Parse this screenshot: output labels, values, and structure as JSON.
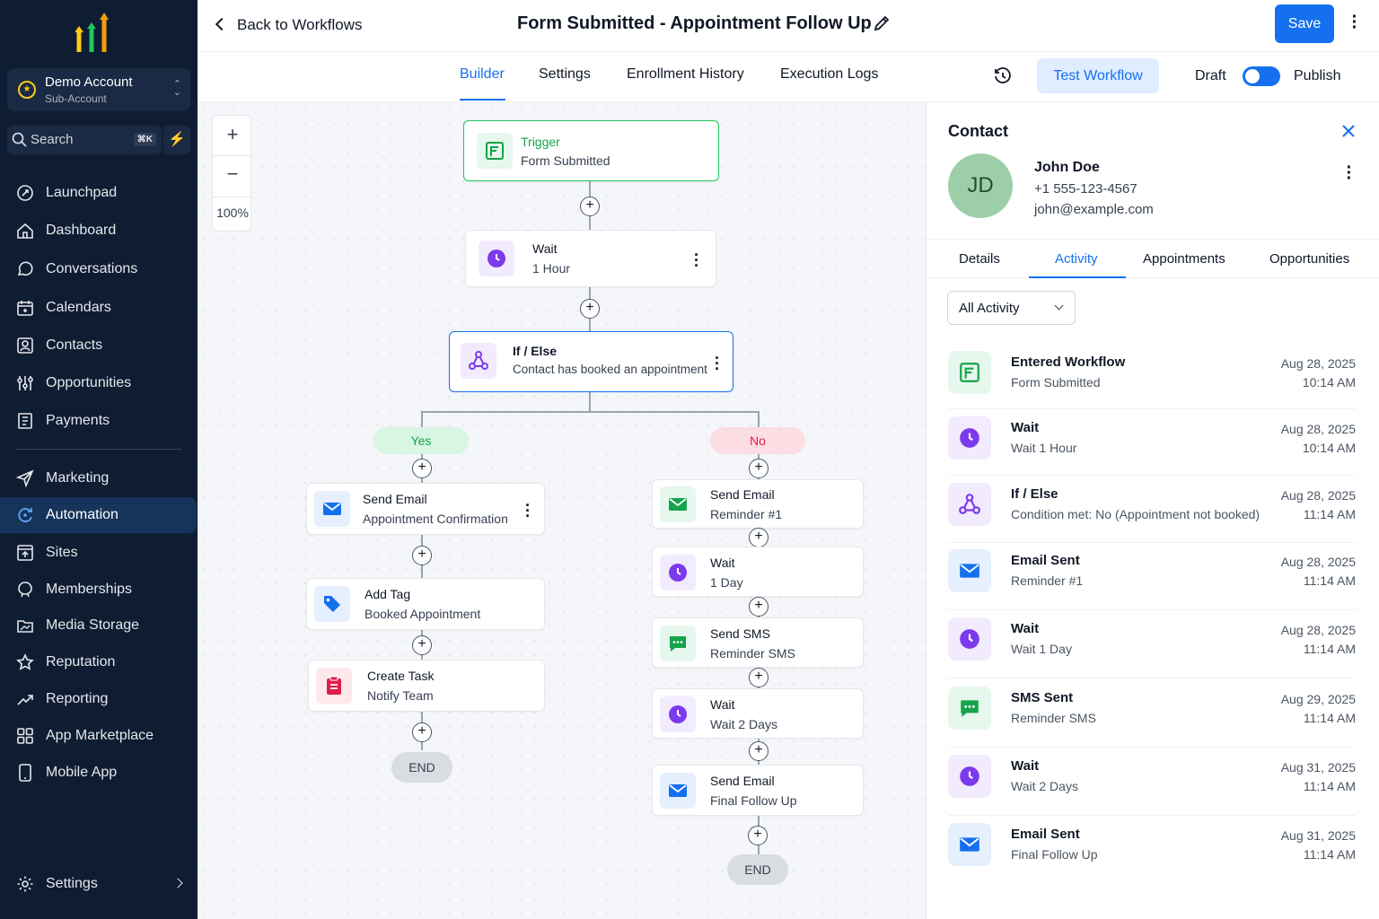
{
  "sidebar": {
    "account_name": "Demo Account",
    "account_sub": "Sub-Account",
    "search_label": "Search",
    "search_shortcut": "⌘K",
    "items": [
      {
        "label": "Launchpad",
        "icon": "rocket-icon"
      },
      {
        "label": "Dashboard",
        "icon": "dashboard-icon"
      },
      {
        "label": "Conversations",
        "icon": "chat-icon"
      },
      {
        "label": "Calendars",
        "icon": "calendar-icon"
      },
      {
        "label": "Contacts",
        "icon": "contact-icon"
      },
      {
        "label": "Opportunities",
        "icon": "funnel-icon"
      },
      {
        "label": "Payments",
        "icon": "receipt-icon"
      },
      {
        "label": "Marketing",
        "icon": "send-icon"
      },
      {
        "label": "Automation",
        "icon": "automation-icon"
      },
      {
        "label": "Sites",
        "icon": "sites-icon"
      },
      {
        "label": "Memberships",
        "icon": "membership-icon"
      },
      {
        "label": "Media Storage",
        "icon": "folder-icon"
      },
      {
        "label": "Reputation",
        "icon": "star-icon"
      },
      {
        "label": "Reporting",
        "icon": "chart-icon"
      },
      {
        "label": "App Marketplace",
        "icon": "grid-icon"
      },
      {
        "label": "Mobile App",
        "icon": "phone-icon"
      }
    ],
    "settings_label": "Settings",
    "active": "Automation"
  },
  "header": {
    "back_label": "Back to Workflows",
    "title": "Form Submitted - Appointment Follow Up",
    "save_label": "Save"
  },
  "tabs": {
    "items": [
      "Builder",
      "Settings",
      "Enrollment History",
      "Execution Logs"
    ],
    "active": "Builder",
    "test_label": "Test Workflow",
    "draft_label": "Draft",
    "publish_label": "Publish"
  },
  "canvas": {
    "zoom_in": "+",
    "zoom_out": "−",
    "zoom_level": "100%",
    "trigger": {
      "title": "Trigger",
      "subtitle": "Form Submitted"
    },
    "wait1": {
      "title": "Wait",
      "subtitle": "1 Hour"
    },
    "ifelse": {
      "title": "If / Else",
      "subtitle": "Contact has booked an appointment"
    },
    "yes_label": "Yes",
    "no_label": "No",
    "yes_branch": [
      {
        "title": "Send Email",
        "subtitle": "Appointment Confirmation"
      },
      {
        "title": "Add Tag",
        "subtitle": "Booked Appointment"
      },
      {
        "title": "Create Task",
        "subtitle": "Notify Team"
      }
    ],
    "no_branch": [
      {
        "title": "Send Email",
        "subtitle": "Reminder #1"
      },
      {
        "title": "Wait",
        "subtitle": "1 Day"
      },
      {
        "title": "Send SMS",
        "subtitle": "Reminder SMS"
      },
      {
        "title": "Wait",
        "subtitle": "Wait 2 Days"
      },
      {
        "title": "Send Email",
        "subtitle": "Final Follow Up"
      }
    ],
    "end_label": "END"
  },
  "contact": {
    "heading": "Contact",
    "initials": "JD",
    "name": "John Doe",
    "phone": "+1 555-123-4567",
    "email": "john@example.com",
    "tabs": [
      "Details",
      "Activity",
      "Appointments",
      "Opportunities"
    ],
    "active_tab": "Activity",
    "filter": "All Activity",
    "activity": [
      {
        "title": "Entered Workflow",
        "detail": "Form Submitted",
        "date": "Aug 28, 2025",
        "time": "10:14 AM"
      },
      {
        "title": "Wait",
        "detail": "Wait 1 Hour",
        "date": "Aug 28, 2025",
        "time": "10:14 AM"
      },
      {
        "title": "If / Else",
        "detail": "Condition met: No (Appointment not booked)",
        "date": "Aug 28, 2025",
        "time": "11:14 AM"
      },
      {
        "title": "Email Sent",
        "detail": "Reminder #1",
        "date": "Aug 28, 2025",
        "time": "11:14 AM"
      },
      {
        "title": "Wait",
        "detail": "Wait 1 Day",
        "date": "Aug 28, 2025",
        "time": "11:14 AM"
      },
      {
        "title": "SMS Sent",
        "detail": "Reminder SMS",
        "date": "Aug 29, 2025",
        "time": "11:14 AM"
      },
      {
        "title": "Wait",
        "detail": "Wait 2 Days",
        "date": "Aug 31, 2025",
        "time": "11:14 AM"
      },
      {
        "title": "Email Sent",
        "detail": "Final Follow Up",
        "date": "Aug 31, 2025",
        "time": "11:14 AM"
      }
    ]
  },
  "colors": {
    "brand_blue": "#1570ef",
    "sidebar_bg": "#0f1d33",
    "green": "#16a34a",
    "purple": "#7c3aed",
    "red": "#e11d48"
  }
}
